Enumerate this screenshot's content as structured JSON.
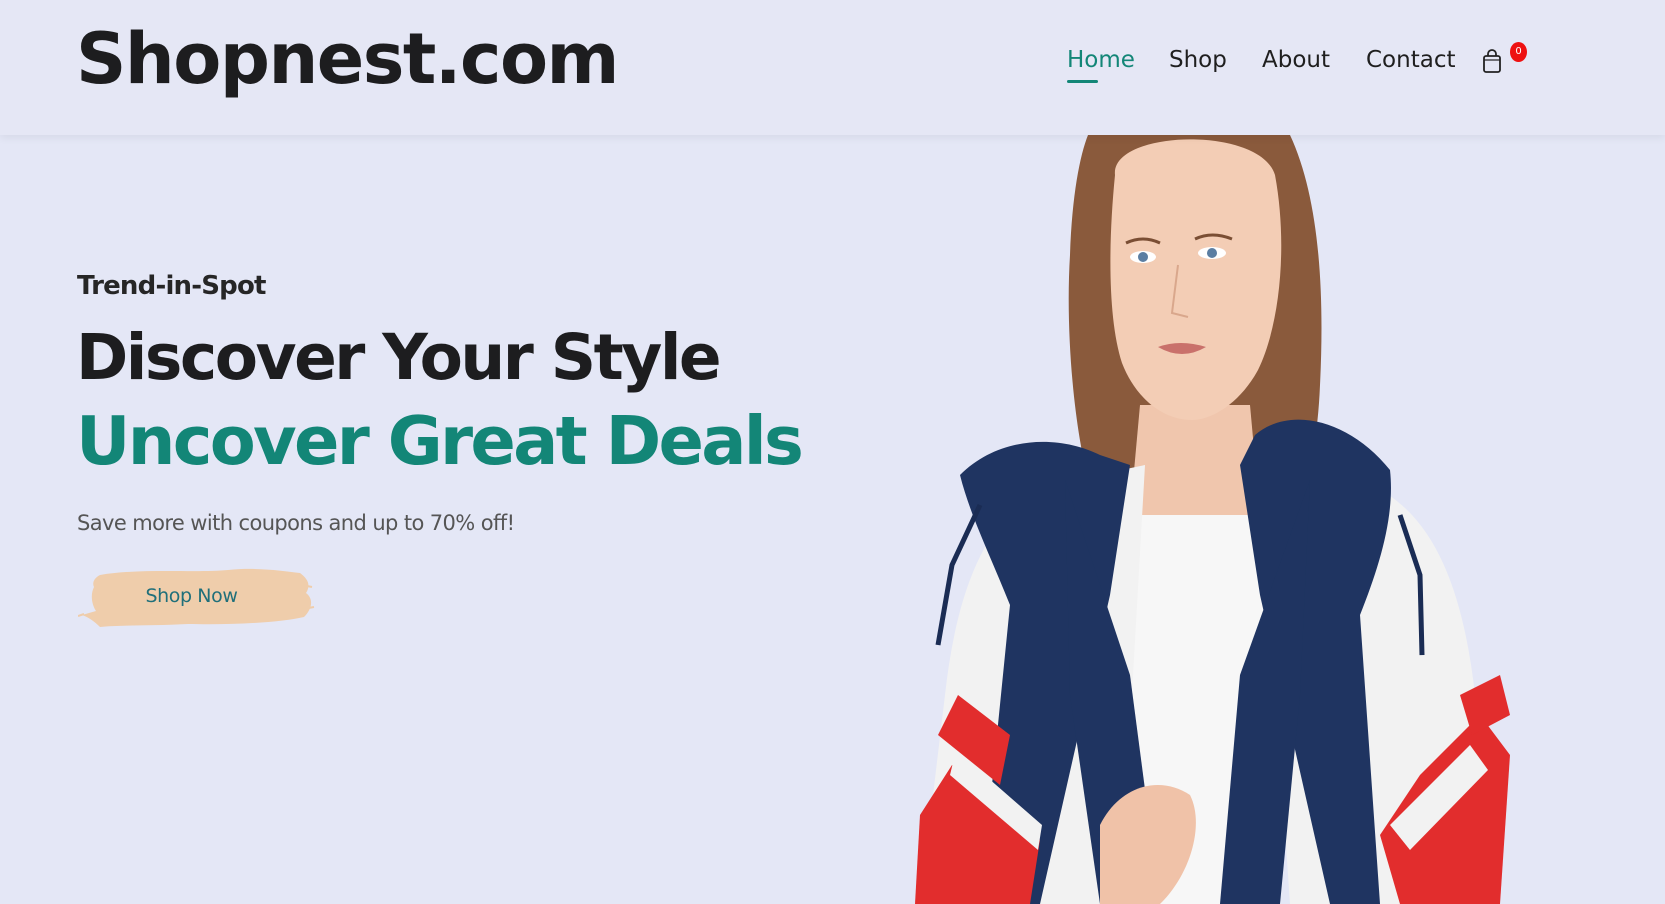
{
  "brand": {
    "logo_text": "Shopnest.com"
  },
  "nav": {
    "items": [
      {
        "label": "Home",
        "active": true
      },
      {
        "label": "Shop",
        "active": false
      },
      {
        "label": "About",
        "active": false
      },
      {
        "label": "Contact",
        "active": false
      }
    ],
    "cart": {
      "icon": "shopping-bag-icon",
      "count": "0"
    }
  },
  "hero": {
    "eyebrow": "Trend-in-Spot",
    "title_line1": "Discover Your Style",
    "title_line2": "Uncover Great Deals",
    "description": "Save more with coupons and up to 70% off!",
    "cta_label": "Shop Now"
  },
  "colors": {
    "background": "#e4e7f6",
    "accent": "#138677",
    "text_dark": "#1d1d1f",
    "button_brush": "#efcdab",
    "badge": "#ee1111"
  }
}
